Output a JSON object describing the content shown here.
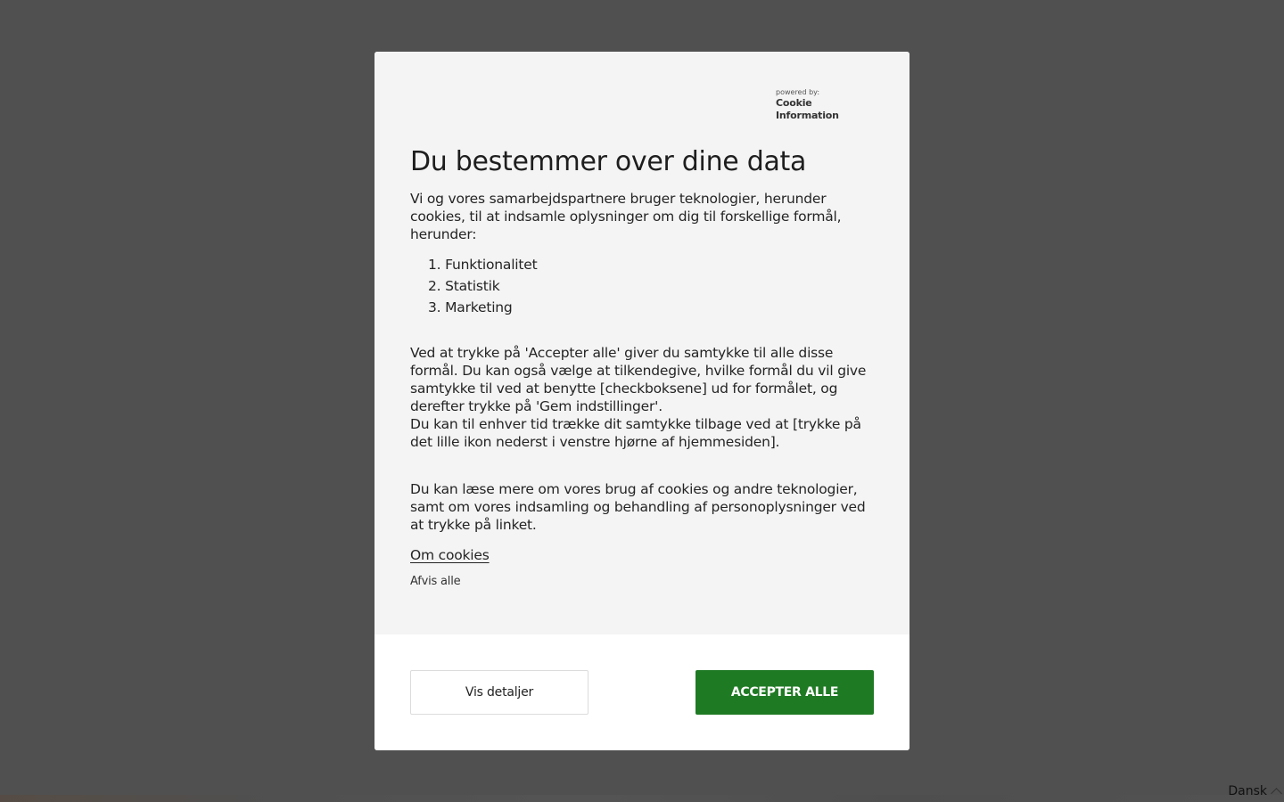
{
  "consent_dialog": {
    "brand": {
      "powered_by": "powered by:",
      "name": "Cookie Information"
    },
    "title": "Du bestemmer over dine data",
    "intro": "Vi og vores samarbejdspartnere bruger teknologier, herunder cookies, til at indsamle oplysninger om dig til forskellige formål, herunder:",
    "purposes": [
      "1. Funktionalitet",
      "2. Statistik",
      "3. Marketing"
    ],
    "consent_text": "Ved at trykke på 'Accepter alle' giver du samtykke til alle disse formål. Du kan også vælge at tilkendegive, hvilke formål du vil give samtykke til ved at benytte [checkboksene] ud for formålet, og derefter trykke på 'Gem indstillinger'.",
    "withdraw_text": "Du kan til enhver tid trække dit samtykke tilbage ved at [trykke på det lille ikon nederst i venstre hjørne af hjemmesiden].",
    "more_info_text": "Du kan læse mere om vores brug af cookies og andre teknologier, samt om vores indsamling og behandling af personoplysninger ved at trykke på linket.",
    "about_cookies_link": "Om cookies",
    "reject_all": "Afvis alle",
    "show_details_button": "Vis detaljer",
    "accept_all_button": "ACCEPTER ALLE",
    "accent_color": "#1f7a24"
  },
  "language_selector": {
    "label": "Dansk",
    "icon": "chevron-up-icon"
  }
}
